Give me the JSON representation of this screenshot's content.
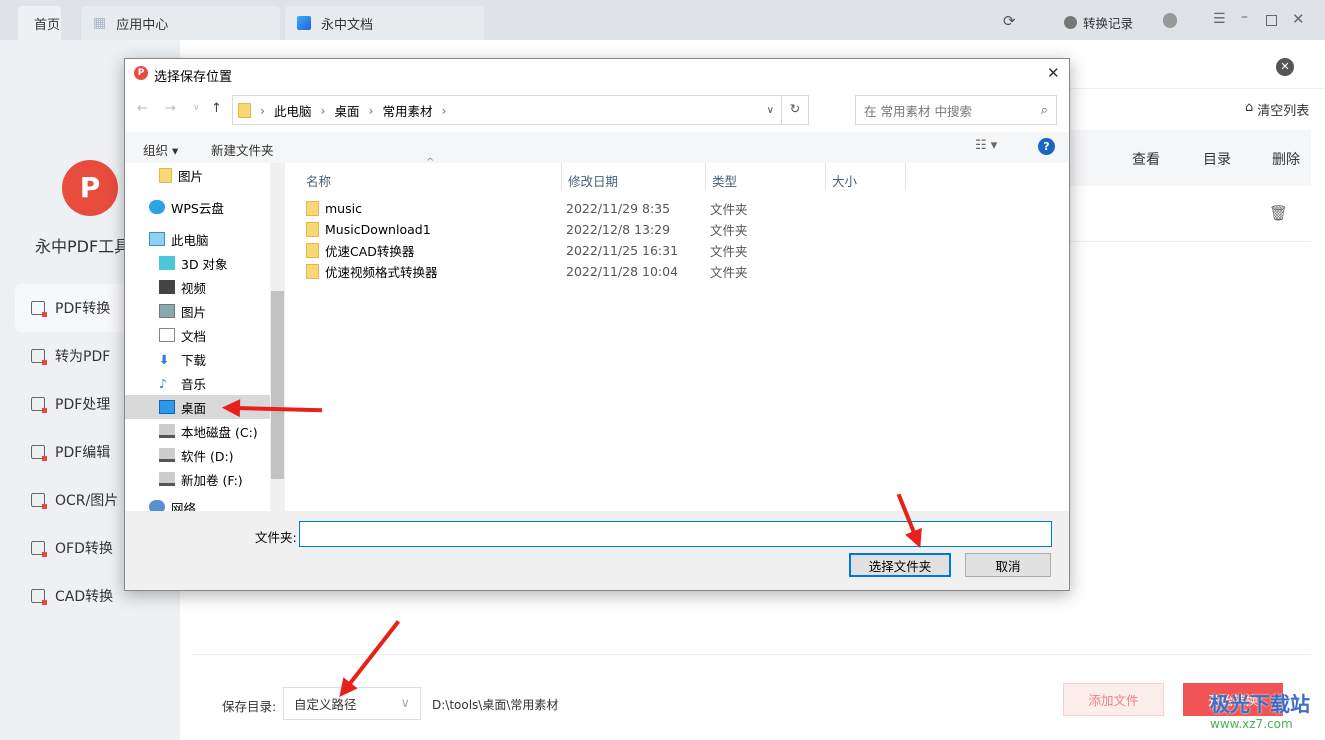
{
  "app": {
    "tabs": [
      {
        "label": "首页",
        "active": true
      },
      {
        "label": "应用中心",
        "icon": "grid-icon"
      },
      {
        "label": "永中文档",
        "icon": "doc-app-icon"
      }
    ],
    "topbar": {
      "history_label": "转换记录"
    },
    "brand": "永中PDF工具",
    "sidebar": [
      {
        "label": "PDF转换",
        "active": true
      },
      {
        "label": "转为PDF"
      },
      {
        "label": "PDF处理"
      },
      {
        "label": "PDF编辑"
      },
      {
        "label": "OCR/图片"
      },
      {
        "label": "OFD转换"
      },
      {
        "label": "CAD转换"
      }
    ],
    "main": {
      "clear_list": "清空列表",
      "columns_actions": [
        "查看",
        "目录",
        "删除"
      ],
      "save_dir_label": "保存目录:",
      "save_dir_select": "自定义路径",
      "save_path": "D:\\tools\\桌面\\常用素材",
      "add_file": "添加文件",
      "start": "开始转换"
    }
  },
  "dialog": {
    "title": "选择保存位置",
    "breadcrumb": [
      "此电脑",
      "桌面",
      "常用素材"
    ],
    "search_placeholder": "在 常用素材 中搜索",
    "organize": "组织",
    "new_folder": "新建文件夹",
    "nav": [
      {
        "label": "图片",
        "icon": "folder-icon"
      },
      {
        "label": "WPS云盘",
        "icon": "cloud-icon"
      },
      {
        "label": "此电脑",
        "icon": "computer-icon"
      },
      {
        "label": "3D 对象",
        "icon": "cube-icon"
      },
      {
        "label": "视频",
        "icon": "video-icon"
      },
      {
        "label": "图片",
        "icon": "picture-icon"
      },
      {
        "label": "文档",
        "icon": "document-icon"
      },
      {
        "label": "下载",
        "icon": "download-icon"
      },
      {
        "label": "音乐",
        "icon": "music-icon"
      },
      {
        "label": "桌面",
        "icon": "desktop-icon",
        "selected": true
      },
      {
        "label": "本地磁盘 (C:)",
        "icon": "drive-icon"
      },
      {
        "label": "软件 (D:)",
        "icon": "drive-icon"
      },
      {
        "label": "新加卷 (F:)",
        "icon": "drive-icon"
      },
      {
        "label": "网络",
        "icon": "network-icon"
      }
    ],
    "columns": [
      "名称",
      "修改日期",
      "类型",
      "大小"
    ],
    "files": [
      {
        "name": "music",
        "date": "2022/11/29 8:35",
        "type": "文件夹"
      },
      {
        "name": "MusicDownload1",
        "date": "2022/12/8 13:29",
        "type": "文件夹"
      },
      {
        "name": "优速CAD转换器",
        "date": "2022/11/25 16:31",
        "type": "文件夹"
      },
      {
        "name": "优速视频格式转换器",
        "date": "2022/11/28 10:04",
        "type": "文件夹"
      }
    ],
    "folder_label": "文件夹:",
    "folder_value": "",
    "select_button": "选择文件夹",
    "cancel_button": "取消"
  },
  "watermark": {
    "text": "极光下载站",
    "url": "www.xz7.com"
  },
  "colors": {
    "accent": "#e8201a",
    "brand": "#e84c3d",
    "topbar": "#dfe3e8",
    "sidebar": "#eef1f4"
  }
}
